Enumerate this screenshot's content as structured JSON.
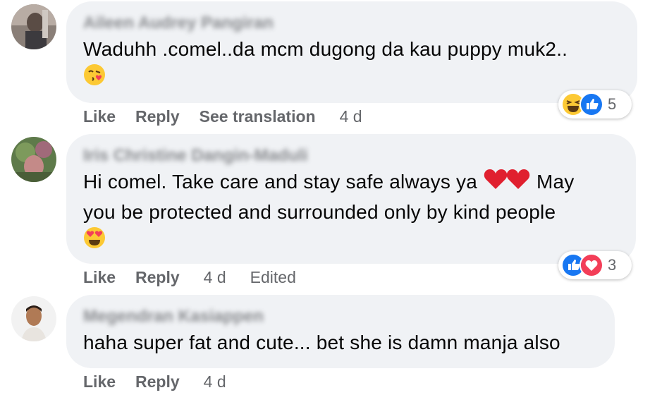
{
  "comments": [
    {
      "author": "Aileen Audrey Pangiran",
      "lines": [
        "Waduhh .comel..da mcm dugong da kau puppy muk2.."
      ],
      "emoji": "face-blowing-kiss-icon",
      "reactions": {
        "icons": [
          "haha-reaction-icon",
          "like-reaction-icon"
        ],
        "count": "5"
      },
      "actions": {
        "like": "Like",
        "reply": "Reply",
        "translate": "See translation",
        "time": "4 d"
      }
    },
    {
      "author": "Iris Christine Dangin-Maduli",
      "line1_start": "Hi comel. Take care and stay safe always ya",
      "line1_end": "May",
      "line2": "you be protected and surrounded only by kind people",
      "emoji": "smiling-face-heart-eyes-icon",
      "reactions": {
        "icons": [
          "like-reaction-icon",
          "love-reaction-icon"
        ],
        "count": "3"
      },
      "actions": {
        "like": "Like",
        "reply": "Reply",
        "time": "4 d",
        "edited": "Edited"
      }
    },
    {
      "author": "Megendran Kasiappen",
      "lines": [
        "haha super fat and cute... bet she is damn manja also"
      ],
      "actions": {
        "like": "Like",
        "reply": "Reply",
        "time": "4 d"
      }
    }
  ],
  "colors": {
    "bubble": "#f0f2f5",
    "secondary_text": "#65676b",
    "like_blue": "#1877f2",
    "love_red": "#f33e58",
    "haha_yellow": "#fcc934"
  }
}
